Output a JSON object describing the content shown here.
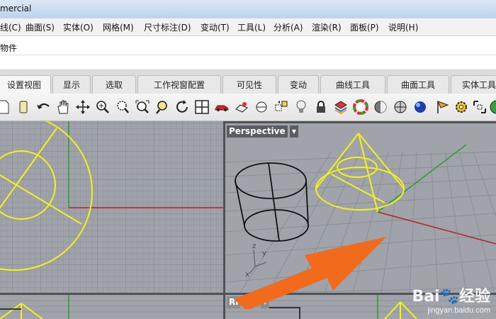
{
  "window": {
    "title": "mercial"
  },
  "menu": [
    {
      "label": "线(C)"
    },
    {
      "label": "曲面(S)"
    },
    {
      "label": "实体(O)"
    },
    {
      "label": "网格(M)"
    },
    {
      "label": "尺寸标注(D)"
    },
    {
      "label": "变动(T)"
    },
    {
      "label": "工具(L)"
    },
    {
      "label": "分析(A)"
    },
    {
      "label": "渲染(R)"
    },
    {
      "label": "面板(P)"
    },
    {
      "label": "说明(H)"
    }
  ],
  "command": {
    "history": "物件"
  },
  "tabs": [
    {
      "label": "设置视图"
    },
    {
      "label": "显示"
    },
    {
      "label": "选取"
    },
    {
      "label": "工作视窗配置"
    },
    {
      "label": "可见性"
    },
    {
      "label": "变动"
    },
    {
      "label": "曲线工具"
    },
    {
      "label": "曲面工具"
    },
    {
      "label": "实体工具"
    }
  ],
  "toolbar_icons": [
    "new-icon",
    "open-icon",
    "undo-icon",
    "pan-hand-icon",
    "rotate-view-icon",
    "zoom-icon",
    "zoom-dynamic-icon",
    "zoom-extents-icon",
    "zoom-selected-icon",
    "rotate-icon",
    "four-views-icon",
    "car-icon",
    "named-views-icon",
    "viewport-target-icon",
    "set-cplane-icon",
    "light-icon",
    "lock-icon",
    "layer-colors-icon",
    "color-wheel-icon",
    "shaded-display-icon",
    "rendered-display-icon",
    "render-sphere-icon",
    "flag-icon",
    "settings-gear-icon",
    "grid-snap-icon",
    "help-icon"
  ],
  "viewports": {
    "perspective": {
      "label": "Perspective"
    },
    "right": {
      "label": "Ri"
    }
  },
  "axis": {
    "x": "x",
    "y": "y",
    "z": "z"
  },
  "watermark": {
    "brand": "Bai🐾经验",
    "url": "jingyan.baidu.com"
  },
  "colors": {
    "curve": "#f2f21a",
    "grid_bg": "#9fa3a9",
    "x_axis": "#b22222",
    "y_axis": "#2e9a2e",
    "arrow": "#f26a1b"
  }
}
